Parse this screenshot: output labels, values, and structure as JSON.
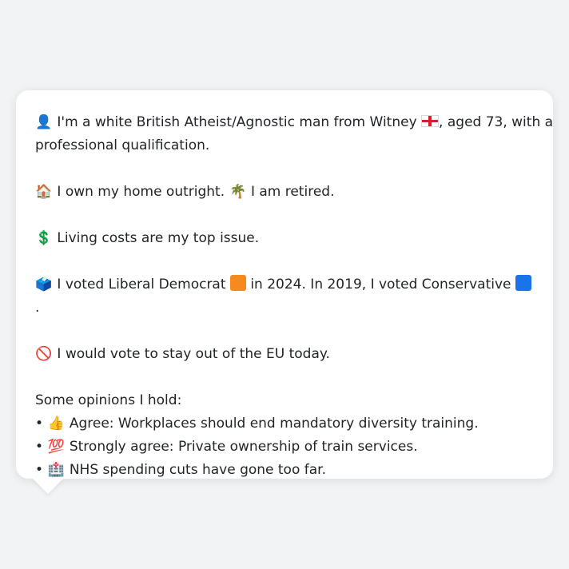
{
  "colors": {
    "background": "#f2f3f5",
    "card": "#ffffff",
    "text": "#222428",
    "lib_dem": "#f68a1f",
    "conservative": "#1a73e8"
  },
  "profile": {
    "intro_pre": "I'm a white British Atheist/Agnostic man from Witney",
    "intro_post": ", aged 73, with a",
    "intro_line2": "professional qualification.",
    "home_icon": "🏠",
    "home": "I own my home outright.",
    "retired_icon": "🌴",
    "retired": "I am retired.",
    "cost_icon": "💲",
    "issue": "Living costs are my top issue.",
    "vote_icon": "🗳️",
    "vote_pre": "I voted Liberal Democrat",
    "vote_mid": "in 2024. In 2019, I voted Conservative",
    "vote_end": ".",
    "eu_icon": "🚫",
    "eu": "I would vote to stay out of the EU today.",
    "opinions_heading": "Some opinions I hold:",
    "opinions": [
      {
        "bullet": "•",
        "icon": "👍",
        "text": "Agree: Workplaces should end mandatory diversity training."
      },
      {
        "bullet": "•",
        "icon": "💯",
        "text": "Strongly agree: Private ownership of train services."
      },
      {
        "bullet": "•",
        "icon": "🏥",
        "text": "NHS spending cuts have gone too far."
      }
    ]
  }
}
